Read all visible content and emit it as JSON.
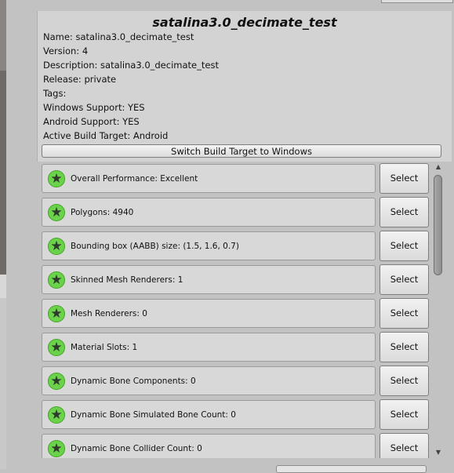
{
  "avatar": {
    "title": "satalina3.0_decimate_test",
    "info": [
      "Name: satalina3.0_decimate_test",
      "Version: 4",
      "Description: satalina3.0_decimate_test",
      "Release: private",
      "Tags:",
      "Windows Support: YES",
      "Android Support: YES",
      "Active Build Target: Android"
    ],
    "switch_button": "Switch Build Target to Windows"
  },
  "stats": {
    "select_label": "Select",
    "rows": [
      "Overall Performance: Excellent",
      "Polygons: 4940",
      "Bounding box (AABB) size: (1.5, 1.6, 0.7)",
      "Skinned Mesh Renderers: 1",
      "Mesh Renderers: 0",
      "Material Slots: 1",
      "Dynamic Bone Components: 0",
      "Dynamic Bone Simulated Bone Count: 0",
      "Dynamic Bone Collider Count: 0"
    ]
  },
  "icons": {
    "rating": "star-icon",
    "scroll_up": "arrow-up-icon",
    "scroll_down": "arrow-down-icon"
  },
  "colors": {
    "rating_excellent": "#6bd34a",
    "panel_bg": "#d3d3d3",
    "window_bg": "#c2c2c2"
  }
}
